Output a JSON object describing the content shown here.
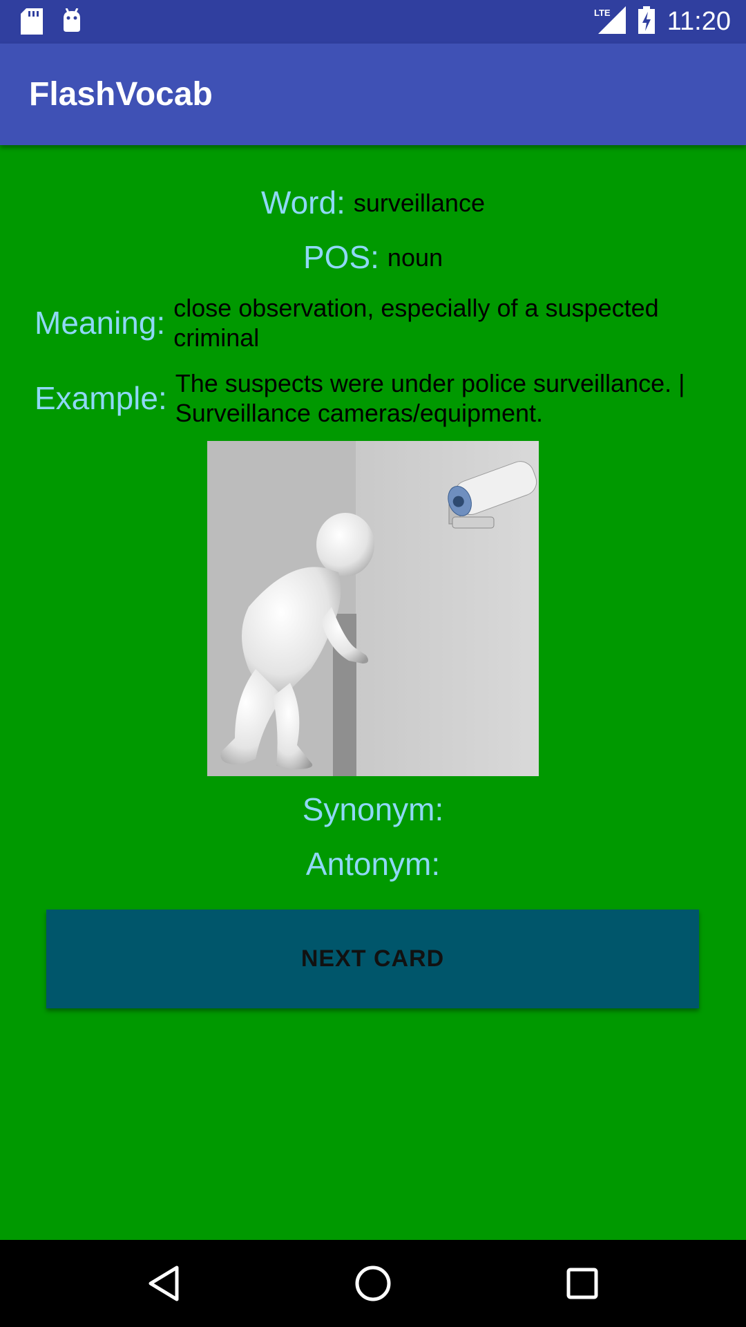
{
  "status_bar": {
    "time": "11:20",
    "network": "LTE",
    "icons": [
      "sd-card-icon",
      "android-icon",
      "lte-signal-icon",
      "battery-charging-icon"
    ]
  },
  "app_bar": {
    "title": "FlashVocab"
  },
  "card": {
    "word_label": "Word:",
    "word": "surveillance",
    "pos_label": "POS:",
    "pos": "noun",
    "meaning_label": "Meaning:",
    "meaning": "close observation, especially of a suspected criminal",
    "example_label": "Example:",
    "example": "The suspects were under police surveillance. | Surveillance cameras/equipment.",
    "image_alt": "figure peeking around a wall with a security camera",
    "synonym_label": "Synonym:",
    "synonym": "",
    "antonym_label": "Antonym:",
    "antonym": ""
  },
  "next_button": {
    "label": "NEXT CARD"
  },
  "navigation": {
    "icons": [
      "back-icon",
      "home-icon",
      "recents-icon"
    ]
  },
  "colors": {
    "status_bar": "#303f9f",
    "app_bar": "#3f51b5",
    "background": "#009900",
    "label": "#8fd8f6",
    "button": "#00566b"
  }
}
